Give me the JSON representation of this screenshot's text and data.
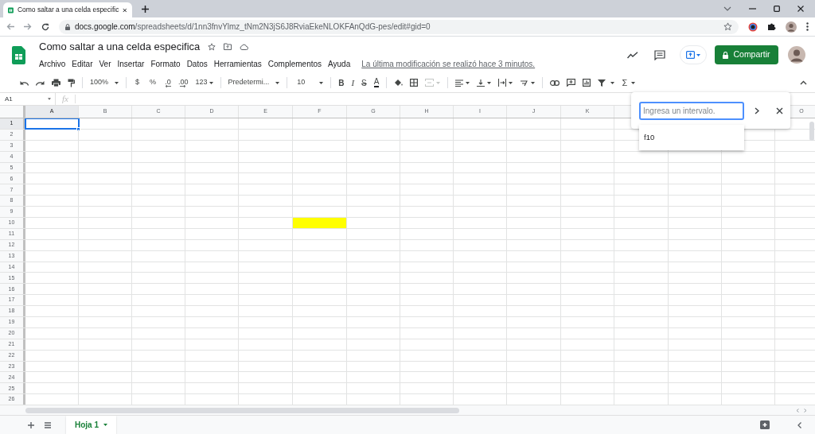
{
  "browser": {
    "tab_title": "Como saltar a una celda especific",
    "url_host": "docs.google.com",
    "url_path": "/spreadsheets/d/1nn3fnvYlmz_tNm2N3jS6J8RviaEkeNLOKFAnQdG-pes/edit#gid=0"
  },
  "document": {
    "title": "Como saltar a una celda especifica",
    "last_edit": "La última modificación se realizó hace 3 minutos.",
    "share_button": "Compartir"
  },
  "menu": [
    "Archivo",
    "Editar",
    "Ver",
    "Insertar",
    "Formato",
    "Datos",
    "Herramientas",
    "Complementos",
    "Ayuda"
  ],
  "toolbar": {
    "zoom": "100%",
    "currency": "$",
    "percent": "%",
    "decrease_decimals": ".0",
    "increase_decimals": ".00",
    "more_formats": "123",
    "font": "Predetermi...",
    "font_size": "10",
    "bold": "B",
    "italic": "I",
    "strikethrough": "S",
    "text_color": "A",
    "functions": "Σ"
  },
  "formula_bar": {
    "name_box": "A1",
    "fx": "fx"
  },
  "columns": [
    {
      "label": "A",
      "selected": true
    },
    {
      "label": "B",
      "selected": false
    },
    {
      "label": "C",
      "selected": false
    },
    {
      "label": "D",
      "selected": false
    },
    {
      "label": "E",
      "selected": false
    },
    {
      "label": "F",
      "selected": false
    },
    {
      "label": "G",
      "selected": false
    },
    {
      "label": "H",
      "selected": false
    },
    {
      "label": "I",
      "selected": false
    },
    {
      "label": "J",
      "selected": false
    },
    {
      "label": "K",
      "selected": false
    },
    {},
    {},
    {},
    {
      "label": "O",
      "selected": false
    }
  ],
  "rows": [
    {
      "label": "1",
      "selected": true,
      "cells": [
        {
          "selected": true
        }
      ]
    },
    {
      "label": "2",
      "selected": false
    },
    {
      "label": "3",
      "selected": false
    },
    {
      "label": "4",
      "selected": false
    },
    {
      "label": "5",
      "selected": false
    },
    {
      "label": "6",
      "selected": false
    },
    {
      "label": "7",
      "selected": false
    },
    {
      "label": "8",
      "selected": false
    },
    {
      "label": "9",
      "selected": false
    },
    {
      "label": "10",
      "selected": false,
      "cells": [
        {
          "selected": false
        },
        {
          "selected": false
        },
        {
          "selected": false
        },
        {
          "selected": false
        },
        {
          "selected": false
        },
        {
          "selected": false,
          "color": "#ffff00"
        }
      ]
    },
    {
      "label": "11",
      "selected": false
    },
    {
      "label": "12",
      "selected": false
    },
    {
      "label": "13",
      "selected": false
    },
    {
      "label": "14",
      "selected": false
    },
    {
      "label": "15",
      "selected": false
    },
    {
      "label": "16",
      "selected": false
    },
    {
      "label": "17",
      "selected": false
    },
    {
      "label": "18",
      "selected": false
    },
    {
      "label": "19",
      "selected": false
    },
    {
      "label": "20",
      "selected": false
    },
    {
      "label": "21",
      "selected": false
    },
    {
      "label": "22",
      "selected": false
    },
    {
      "label": "23",
      "selected": false
    },
    {
      "label": "24",
      "selected": false
    },
    {
      "label": "25",
      "selected": false
    },
    {
      "label": "26",
      "selected": false
    }
  ],
  "go_to_range": {
    "placeholder": "Ingresa un intervalo.",
    "suggestions": [
      "f10"
    ]
  },
  "sheets": [
    {
      "label": "Hoja 1",
      "selected": true
    }
  ]
}
